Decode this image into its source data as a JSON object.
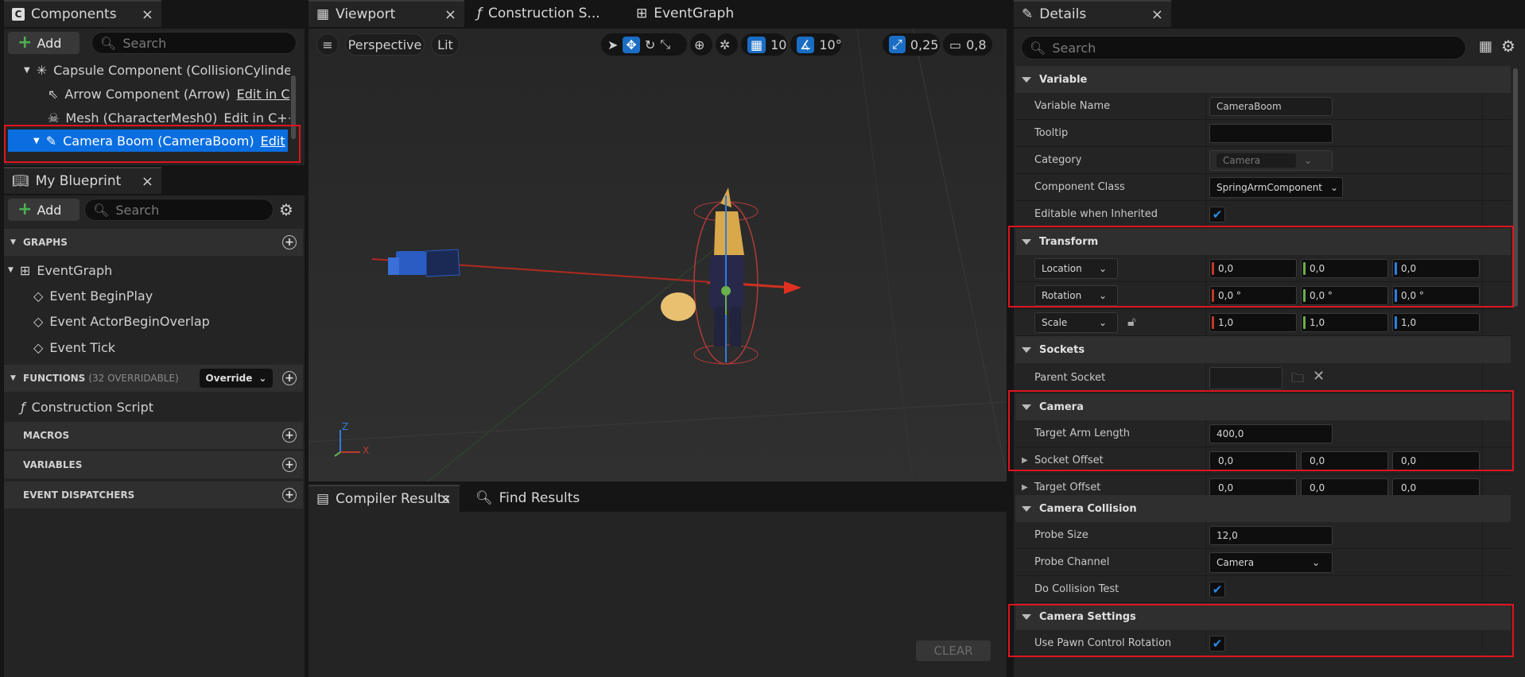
{
  "components": {
    "tab_title": "Components",
    "add_label": "Add",
    "search_placeholder": "Search",
    "items": [
      {
        "label": "Capsule Component (CollisionCylinde",
        "edit": ""
      },
      {
        "label": "Arrow Component (Arrow)",
        "edit": "Edit in C"
      },
      {
        "label": "Mesh (CharacterMesh0)",
        "edit": "Edit in C++"
      },
      {
        "label": "Camera Boom (CameraBoom)",
        "edit": "Edit"
      }
    ]
  },
  "blueprint": {
    "tab_title": "My Blueprint",
    "add_label": "Add",
    "search_placeholder": "Search",
    "graphs_label": "GRAPHS",
    "event_graph": "EventGraph",
    "events": [
      "Event BeginPlay",
      "Event ActorBeginOverlap",
      "Event Tick"
    ],
    "functions_label": "FUNCTIONS",
    "functions_count": "(32 OVERRIDABLE)",
    "override_label": "Override",
    "construction_script": "Construction Script",
    "macros_label": "MACROS",
    "variables_label": "VARIABLES",
    "dispatchers_label": "EVENT DISPATCHERS"
  },
  "center_tabs": {
    "viewport": "Viewport",
    "construction": "Construction S...",
    "eventgraph": "EventGraph"
  },
  "viewport": {
    "perspective": "Perspective",
    "lit": "Lit",
    "grid_snap": "10",
    "rot_snap": "10°",
    "scale_snap": "0,25",
    "cam_speed": "0,8",
    "axis_z": "Z",
    "axis_x": "X"
  },
  "bottom": {
    "compiler_tab": "Compiler Results",
    "find_tab": "Find Results",
    "clear": "CLEAR"
  },
  "details": {
    "tab_title": "Details",
    "search_placeholder": "Search",
    "variable_section": "Variable",
    "variable_name_label": "Variable Name",
    "variable_name": "CameraBoom",
    "tooltip_label": "Tooltip",
    "category_label": "Category",
    "category_value": "Camera",
    "component_class_label": "Component Class",
    "component_class_value": "SpringArmComponent",
    "editable_label": "Editable when Inherited",
    "transform_section": "Transform",
    "location_label": "Location",
    "location": [
      "0,0",
      "0,0",
      "0,0"
    ],
    "rotation_label": "Rotation",
    "rotation": [
      "0,0 °",
      "0,0 °",
      "0,0 °"
    ],
    "scale_label": "Scale",
    "scale": [
      "1,0",
      "1,0",
      "1,0"
    ],
    "sockets_section": "Sockets",
    "parent_socket_label": "Parent Socket",
    "camera_section": "Camera",
    "target_arm_label": "Target Arm Length",
    "target_arm_value": "400,0",
    "socket_offset_label": "Socket Offset",
    "socket_offset": [
      "0,0",
      "0,0",
      "0,0"
    ],
    "target_offset_label": "Target Offset",
    "target_offset": [
      "0,0",
      "0,0",
      "0,0"
    ],
    "collision_section": "Camera Collision",
    "probe_size_label": "Probe Size",
    "probe_size_value": "12,0",
    "probe_channel_label": "Probe Channel",
    "probe_channel_value": "Camera",
    "do_collision_label": "Do Collision Test",
    "camera_settings_section": "Camera Settings",
    "use_pawn_label": "Use Pawn Control Rotation"
  },
  "colors": {
    "accent": "#1a6dc4",
    "highlight": "#e0141e",
    "x_axis": "#c0392b",
    "y_axis": "#6ab04c",
    "z_axis": "#2e7de0"
  }
}
